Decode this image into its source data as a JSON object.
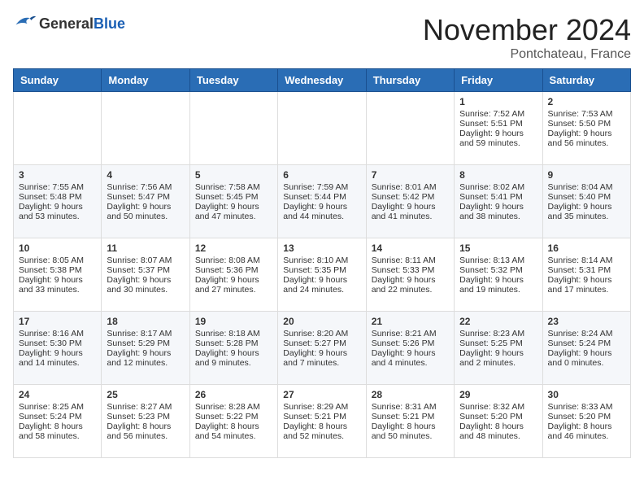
{
  "header": {
    "logo_general": "General",
    "logo_blue": "Blue",
    "month_title": "November 2024",
    "location": "Pontchateau, France"
  },
  "weekdays": [
    "Sunday",
    "Monday",
    "Tuesday",
    "Wednesday",
    "Thursday",
    "Friday",
    "Saturday"
  ],
  "weeks": [
    [
      {
        "day": "",
        "content": ""
      },
      {
        "day": "",
        "content": ""
      },
      {
        "day": "",
        "content": ""
      },
      {
        "day": "",
        "content": ""
      },
      {
        "day": "",
        "content": ""
      },
      {
        "day": "1",
        "content": "Sunrise: 7:52 AM\nSunset: 5:51 PM\nDaylight: 9 hours and 59 minutes."
      },
      {
        "day": "2",
        "content": "Sunrise: 7:53 AM\nSunset: 5:50 PM\nDaylight: 9 hours and 56 minutes."
      }
    ],
    [
      {
        "day": "3",
        "content": "Sunrise: 7:55 AM\nSunset: 5:48 PM\nDaylight: 9 hours and 53 minutes."
      },
      {
        "day": "4",
        "content": "Sunrise: 7:56 AM\nSunset: 5:47 PM\nDaylight: 9 hours and 50 minutes."
      },
      {
        "day": "5",
        "content": "Sunrise: 7:58 AM\nSunset: 5:45 PM\nDaylight: 9 hours and 47 minutes."
      },
      {
        "day": "6",
        "content": "Sunrise: 7:59 AM\nSunset: 5:44 PM\nDaylight: 9 hours and 44 minutes."
      },
      {
        "day": "7",
        "content": "Sunrise: 8:01 AM\nSunset: 5:42 PM\nDaylight: 9 hours and 41 minutes."
      },
      {
        "day": "8",
        "content": "Sunrise: 8:02 AM\nSunset: 5:41 PM\nDaylight: 9 hours and 38 minutes."
      },
      {
        "day": "9",
        "content": "Sunrise: 8:04 AM\nSunset: 5:40 PM\nDaylight: 9 hours and 35 minutes."
      }
    ],
    [
      {
        "day": "10",
        "content": "Sunrise: 8:05 AM\nSunset: 5:38 PM\nDaylight: 9 hours and 33 minutes."
      },
      {
        "day": "11",
        "content": "Sunrise: 8:07 AM\nSunset: 5:37 PM\nDaylight: 9 hours and 30 minutes."
      },
      {
        "day": "12",
        "content": "Sunrise: 8:08 AM\nSunset: 5:36 PM\nDaylight: 9 hours and 27 minutes."
      },
      {
        "day": "13",
        "content": "Sunrise: 8:10 AM\nSunset: 5:35 PM\nDaylight: 9 hours and 24 minutes."
      },
      {
        "day": "14",
        "content": "Sunrise: 8:11 AM\nSunset: 5:33 PM\nDaylight: 9 hours and 22 minutes."
      },
      {
        "day": "15",
        "content": "Sunrise: 8:13 AM\nSunset: 5:32 PM\nDaylight: 9 hours and 19 minutes."
      },
      {
        "day": "16",
        "content": "Sunrise: 8:14 AM\nSunset: 5:31 PM\nDaylight: 9 hours and 17 minutes."
      }
    ],
    [
      {
        "day": "17",
        "content": "Sunrise: 8:16 AM\nSunset: 5:30 PM\nDaylight: 9 hours and 14 minutes."
      },
      {
        "day": "18",
        "content": "Sunrise: 8:17 AM\nSunset: 5:29 PM\nDaylight: 9 hours and 12 minutes."
      },
      {
        "day": "19",
        "content": "Sunrise: 8:18 AM\nSunset: 5:28 PM\nDaylight: 9 hours and 9 minutes."
      },
      {
        "day": "20",
        "content": "Sunrise: 8:20 AM\nSunset: 5:27 PM\nDaylight: 9 hours and 7 minutes."
      },
      {
        "day": "21",
        "content": "Sunrise: 8:21 AM\nSunset: 5:26 PM\nDaylight: 9 hours and 4 minutes."
      },
      {
        "day": "22",
        "content": "Sunrise: 8:23 AM\nSunset: 5:25 PM\nDaylight: 9 hours and 2 minutes."
      },
      {
        "day": "23",
        "content": "Sunrise: 8:24 AM\nSunset: 5:24 PM\nDaylight: 9 hours and 0 minutes."
      }
    ],
    [
      {
        "day": "24",
        "content": "Sunrise: 8:25 AM\nSunset: 5:24 PM\nDaylight: 8 hours and 58 minutes."
      },
      {
        "day": "25",
        "content": "Sunrise: 8:27 AM\nSunset: 5:23 PM\nDaylight: 8 hours and 56 minutes."
      },
      {
        "day": "26",
        "content": "Sunrise: 8:28 AM\nSunset: 5:22 PM\nDaylight: 8 hours and 54 minutes."
      },
      {
        "day": "27",
        "content": "Sunrise: 8:29 AM\nSunset: 5:21 PM\nDaylight: 8 hours and 52 minutes."
      },
      {
        "day": "28",
        "content": "Sunrise: 8:31 AM\nSunset: 5:21 PM\nDaylight: 8 hours and 50 minutes."
      },
      {
        "day": "29",
        "content": "Sunrise: 8:32 AM\nSunset: 5:20 PM\nDaylight: 8 hours and 48 minutes."
      },
      {
        "day": "30",
        "content": "Sunrise: 8:33 AM\nSunset: 5:20 PM\nDaylight: 8 hours and 46 minutes."
      }
    ]
  ]
}
